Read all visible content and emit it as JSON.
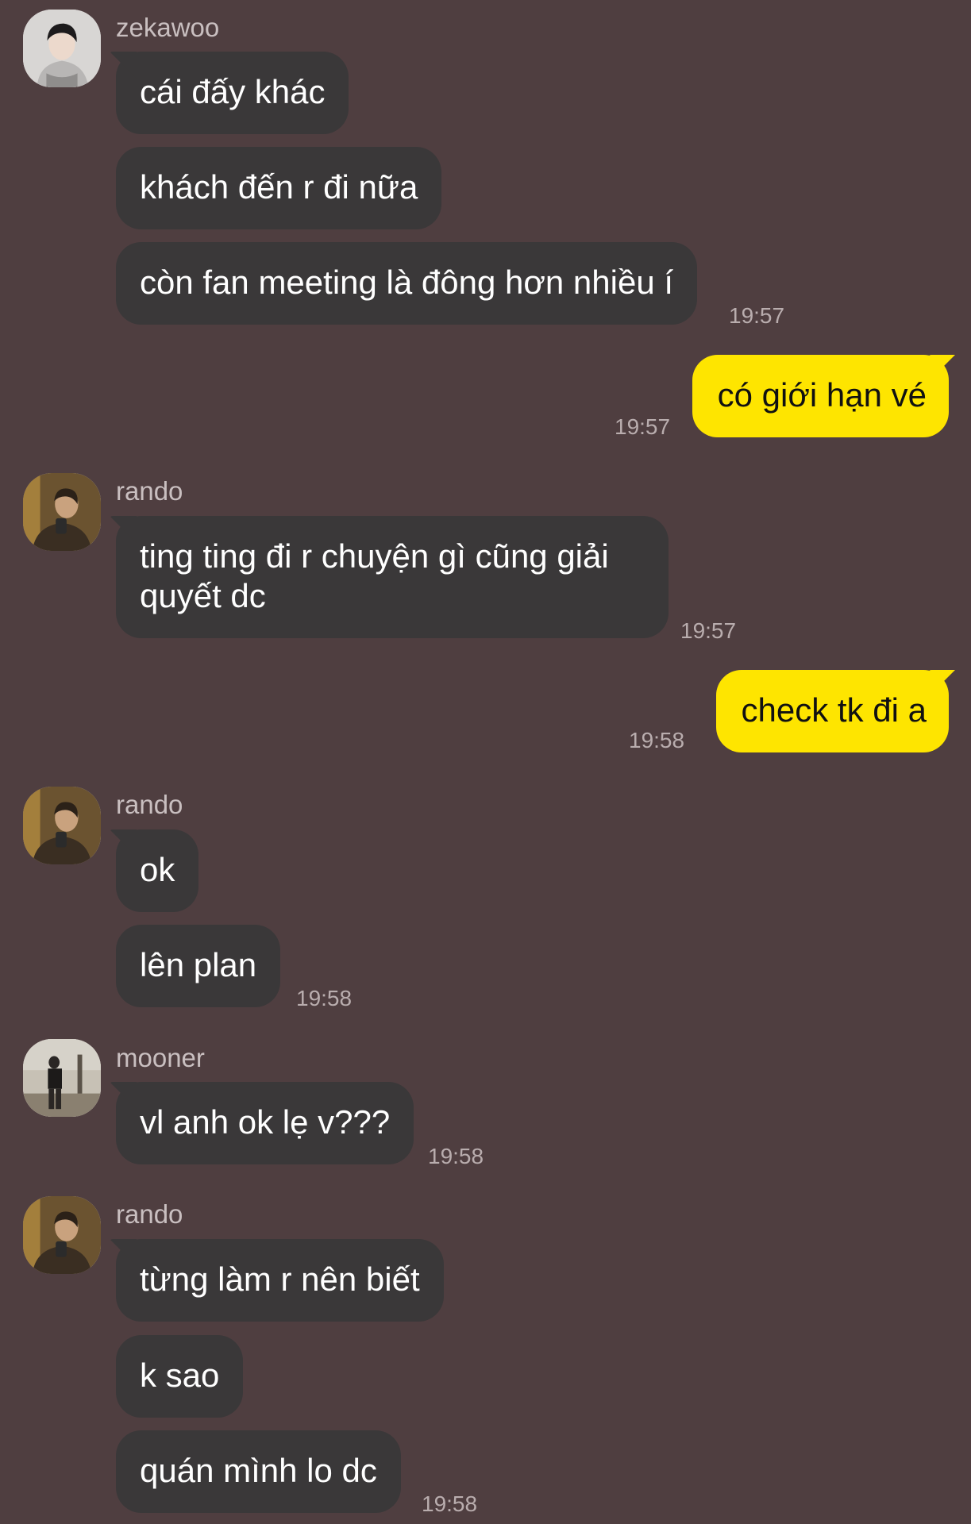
{
  "chat": {
    "groups": [
      {
        "sender": "zekawoo",
        "messages": [
          "cái đấy khác",
          "khách đến r đi nữa",
          "còn fan meeting là đông hơn nhiều í"
        ],
        "time": "19:57"
      },
      {
        "mine": true,
        "messages": [
          "có giới hạn vé"
        ],
        "time": "19:57"
      },
      {
        "sender": "rando",
        "messages": [
          "ting ting đi r chuyện gì cũng giải quyết dc"
        ],
        "time": "19:57"
      },
      {
        "mine": true,
        "messages": [
          "check tk đi a"
        ],
        "time": "19:58"
      },
      {
        "sender": "rando",
        "messages": [
          "ok",
          "lên plan"
        ],
        "time": "19:58"
      },
      {
        "sender": "mooner",
        "messages": [
          "vl anh ok lẹ v???"
        ],
        "time": "19:58"
      },
      {
        "sender": "rando",
        "messages": [
          "từng làm r nên biết",
          "k sao",
          "quán mình lo dc"
        ],
        "time": "19:58"
      }
    ]
  },
  "colors": {
    "background": "#4f3e40",
    "incoming_bubble": "#3a3839",
    "outgoing_bubble": "#fee500"
  }
}
